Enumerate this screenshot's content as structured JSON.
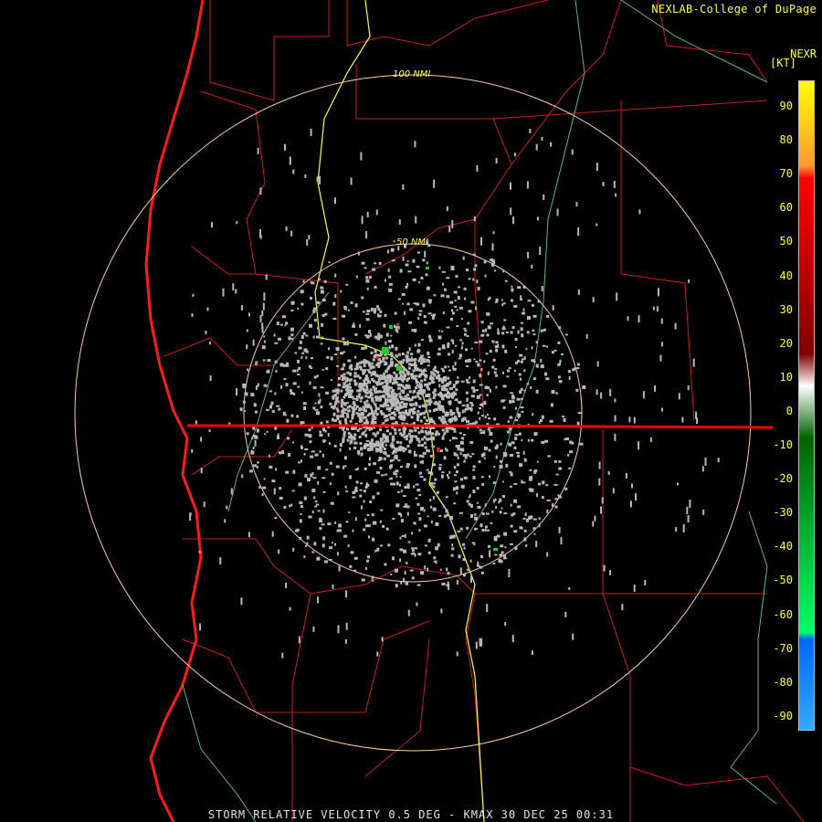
{
  "header": {
    "credit": "NEXLAB-College of DuPage",
    "product": "NEXR",
    "units": "[KT]"
  },
  "footer": {
    "caption": "STORM RELATIVE VELOCITY 0.5 DEG - KMAX 30 DEC 25 00:31"
  },
  "range_rings": [
    {
      "label": "50 NMI"
    },
    {
      "label": "100 NMI"
    }
  ],
  "legend": {
    "ticks": [
      "90",
      "80",
      "70",
      "60",
      "50",
      "40",
      "30",
      "20",
      "10",
      "0",
      "-10",
      "-20",
      "-30",
      "-40",
      "-50",
      "-60",
      "-70",
      "-80",
      "-90"
    ],
    "colors": [
      "#ffff00",
      "#ff9933",
      "#ff0000",
      "#800000",
      "#ffffff",
      "#006400",
      "#00ff66",
      "#0066ff",
      "#33aaff"
    ]
  },
  "colors": {
    "state_border": "#d02020",
    "coast": "#ff1a1a",
    "road": "#ffff33",
    "river": "#66cc88",
    "ring": "#ffcc99",
    "echo": "#b8b8b8"
  }
}
